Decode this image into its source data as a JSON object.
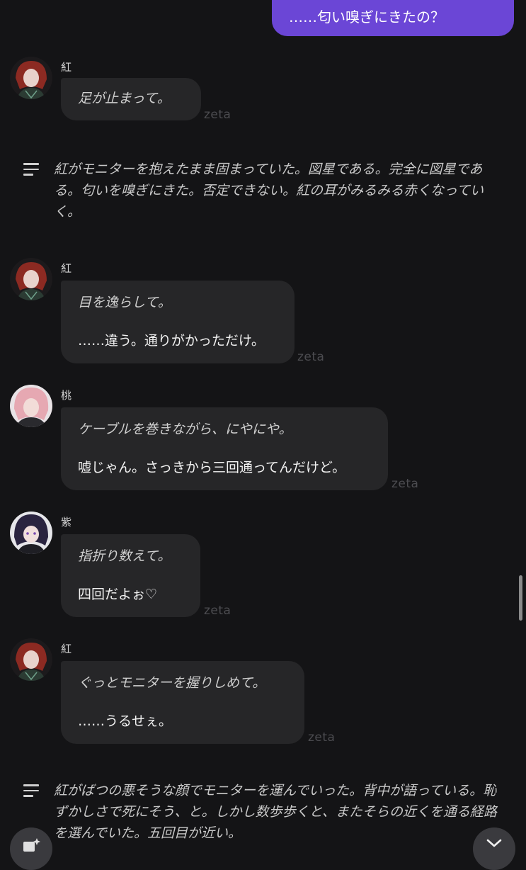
{
  "user_message": {
    "text": "……匂い嗅ぎにきたの？"
  },
  "watermark": "zeta",
  "messages": [
    {
      "name": "紅",
      "action": "足が止まって。",
      "speech": ""
    },
    {
      "name": "紅",
      "action": "目を逸らして。",
      "speech": "……違う。通りがかっただけ。"
    },
    {
      "name": "桃",
      "action": "ケーブルを巻きながら、にやにや。",
      "speech": "嘘じゃん。さっきから三回通ってんだけど。"
    },
    {
      "name": "紫",
      "action": "指折り数えて。",
      "speech": "四回だよぉ♡"
    },
    {
      "name": "紅",
      "action": "ぐっとモニターを握りしめて。",
      "speech": "……うるせぇ。"
    }
  ],
  "narrations": [
    {
      "text": "紅がモニターを抱えたまま固まっていた。図星である。完全に図星である。匂いを嗅ぎにきた。否定できない。紅の耳がみるみる赤くなっていく。"
    },
    {
      "text": "紅がばつの悪そうな顔でモニターを運んでいった。背中が語っている。恥ずかしさで死にそう、と。しかし数歩歩くと、またそらの近くを通る経路を選んでいた。五回目が近い。"
    }
  ],
  "icons": {
    "narration": "menu-lines-icon",
    "left_fab": "image-sparkle-icon",
    "right_fab": "chevron-down-icon"
  },
  "colors": {
    "user_bubble": "#6b46d6",
    "bubble": "#262628",
    "background": "#141416"
  }
}
